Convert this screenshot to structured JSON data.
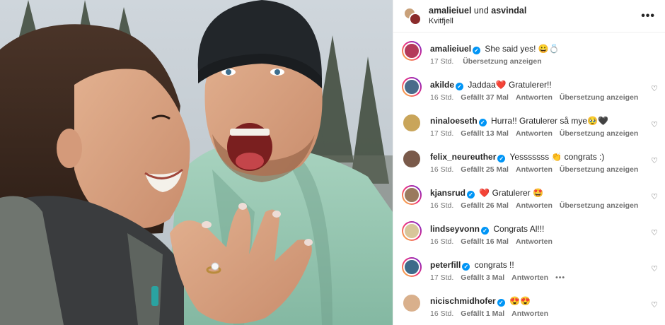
{
  "post": {
    "author_line": "amalieiuel und asvindal",
    "location": "Kvitfjell"
  },
  "caption": {
    "user": "amalieiuel",
    "text": "She said yes! 😀💍",
    "time": "17 Std.",
    "translate": "Übersetzung anzeigen"
  },
  "comments": [
    {
      "user": "akilde",
      "text": "Jaddaa❤️ Gratulerer!!",
      "time": "16 Std.",
      "likes": "Gefällt 37 Mal",
      "reply": "Antworten",
      "translate": "Übersetzung anzeigen",
      "avatar": "#4a6b8a",
      "ring": true
    },
    {
      "user": "ninaloeseth",
      "text": "Hurra!! Gratulerer så mye🥹🖤",
      "time": "17 Std.",
      "likes": "Gefällt 13 Mal",
      "reply": "Antworten",
      "translate": "Übersetzung anzeigen",
      "avatar": "#c9a55a",
      "ring": false
    },
    {
      "user": "felix_neureuther",
      "text": "Yesssssss 👏 congrats :)",
      "time": "16 Std.",
      "likes": "Gefällt 25 Mal",
      "reply": "Antworten",
      "translate": "Übersetzung anzeigen",
      "avatar": "#7a5a4a",
      "ring": false
    },
    {
      "user": "kjansrud",
      "text": "❤️ Gratulerer 🤩",
      "time": "16 Std.",
      "likes": "Gefällt 26 Mal",
      "reply": "Antworten",
      "translate": "Übersetzung anzeigen",
      "avatar": "#9a7a5e",
      "ring": true
    },
    {
      "user": "lindseyvonn",
      "text": "Congrats Al!!!",
      "time": "16 Std.",
      "likes": "Gefällt 16 Mal",
      "reply": "Antworten",
      "translate": "",
      "avatar": "#d8c69a",
      "ring": true
    },
    {
      "user": "peterfill",
      "text": "congrats !!",
      "time": "17 Std.",
      "likes": "Gefällt 3 Mal",
      "reply": "Antworten",
      "translate": "•••",
      "avatar": "#3d6a8a",
      "ring": true
    },
    {
      "user": "nicischmidhofer",
      "text": "😍😍",
      "time": "16 Std.",
      "likes": "Gefällt 1 Mal",
      "reply": "Antworten",
      "translate": "",
      "avatar": "#d9b08c",
      "ring": false
    }
  ],
  "icons": {
    "more": "•••",
    "heart": "♡",
    "verified": "✓"
  },
  "colors": {
    "accent_blue": "#0095f6",
    "muted_text": "#737373",
    "jacket_green": "#8fc2ac"
  }
}
